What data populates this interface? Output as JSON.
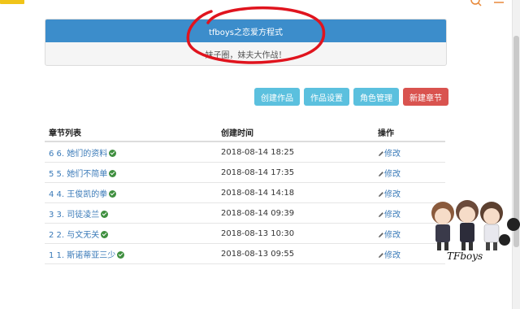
{
  "panel": {
    "title": "tfboys之恋爱方程式",
    "subtitle": "妹子圈，妹夫大作战！"
  },
  "toolbar": {
    "create_work": "创建作品",
    "work_settings": "作品设置",
    "role_management": "角色管理",
    "new_chapter": "新建章节"
  },
  "table": {
    "headers": [
      "章节列表",
      "创建时间",
      "操作"
    ],
    "rows": [
      {
        "chapter": "6 6. 她们的资料",
        "time": "2018-08-14 18:25",
        "action": "修改"
      },
      {
        "chapter": "5 5. 她们不简单",
        "time": "2018-08-14 17:35",
        "action": "修改"
      },
      {
        "chapter": "4 4. 王俊凯的拳",
        "time": "2018-08-14 14:18",
        "action": "修改"
      },
      {
        "chapter": "3 3. 司徒凌兰",
        "time": "2018-08-14 09:39",
        "action": "修改"
      },
      {
        "chapter": "2 2. 与文无关",
        "time": "2018-08-13 10:30",
        "action": "修改"
      },
      {
        "chapter": "1 1. 斯诺蒂亚三少",
        "time": "2018-08-13 09:55",
        "action": "修改"
      }
    ]
  },
  "mascot": {
    "label": "TFboys"
  },
  "colors": {
    "panel_header": "#3c8dcb",
    "button_info": "#5bc0de",
    "button_danger": "#d9534f",
    "annotation_red": "#e0141e",
    "link": "#3a7ab8",
    "verified_green": "#3f8f3f"
  },
  "icons": {
    "verified": "check-circle-icon",
    "edit": "pencil-icon",
    "search": "search-icon",
    "menu": "menu-icon"
  }
}
